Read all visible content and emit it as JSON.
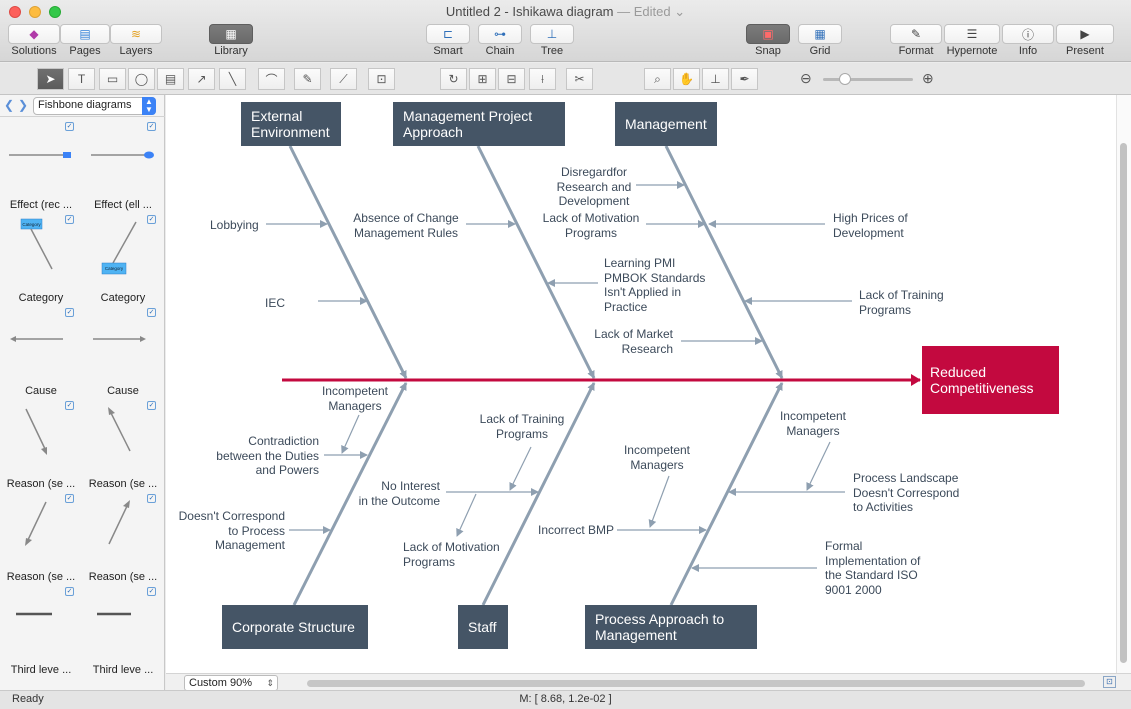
{
  "window": {
    "title": "Untitled 2 - Ishikawa diagram",
    "edited": "— Edited ⌄"
  },
  "toolbar": {
    "solutions": "Solutions",
    "pages": "Pages",
    "layers": "Layers",
    "library": "Library",
    "smart": "Smart",
    "chain": "Chain",
    "tree": "Tree",
    "snap": "Snap",
    "grid": "Grid",
    "format": "Format",
    "hypernote": "Hypernote",
    "info": "Info",
    "present": "Present"
  },
  "library": {
    "selected": "Fishbone diagrams",
    "items": [
      {
        "label": "Effect (rec ..."
      },
      {
        "label": "Effect (ell ..."
      },
      {
        "label": "Category"
      },
      {
        "label": "Category"
      },
      {
        "label": "Cause"
      },
      {
        "label": "Cause"
      },
      {
        "label": "Reason (se ..."
      },
      {
        "label": "Reason (se ..."
      },
      {
        "label": "Reason (se ..."
      },
      {
        "label": "Reason (se ..."
      },
      {
        "label": "Third leve ..."
      },
      {
        "label": "Third leve ..."
      }
    ],
    "category_thumb_text": "Category"
  },
  "diagram": {
    "effect": "Reduced Competitiveness",
    "categories": {
      "external": "External Environment",
      "management_project": "Management Project Approach",
      "management": "Management",
      "corporate": "Corporate Structure",
      "staff": "Staff",
      "process": "Process Approach to Management"
    },
    "causes": {
      "lobbying": "Lobbying",
      "iec": "IEC",
      "absence": "Absence of Change\nManagement Rules",
      "pmi": "Learning PMI\nPMBOK Standards\nIsn't Applied in\nPractice",
      "market": "Lack of  Market\nResearch",
      "disregard": "Disregardfor\nResearch and\nDevelopment",
      "motivation_top": "Lack of Motivation\nPrograms",
      "high_prices": "High Prices of\nDevelopment",
      "training_top": "Lack of Training\nPrograms",
      "incompetent_corp": "Incompetent\nManagers",
      "contradiction": "Contradiction\nbetween the Duties\nand Powers",
      "doesnt_correspond": "Doesn't Correspond\nto Process\nManagement",
      "training_staff": "Lack of Training\nPrograms",
      "no_interest": "No Interest\nin the Outcome",
      "motivation_staff": "Lack of Motivation\nPrograms",
      "incompetent_staff": "Incompetent\nManagers",
      "incorrect_bmp": "Incorrect BMP",
      "incompetent_proc": "Incompetent\nManagers",
      "landscape": "Process Landscape\nDoesn't Correspond\nto Activities",
      "formal": "Formal\nImplementation of\nthe Standard ISO\n9001 2000"
    },
    "colors": {
      "category_fill": "#455566",
      "effect_fill": "#c3093f",
      "bone": "#8e9fb0",
      "spine": "#c3093f"
    }
  },
  "footer": {
    "zoom": "Custom 90%",
    "status": "Ready",
    "mouse": "M: [ 8.68, 1.2e-02 ]"
  }
}
